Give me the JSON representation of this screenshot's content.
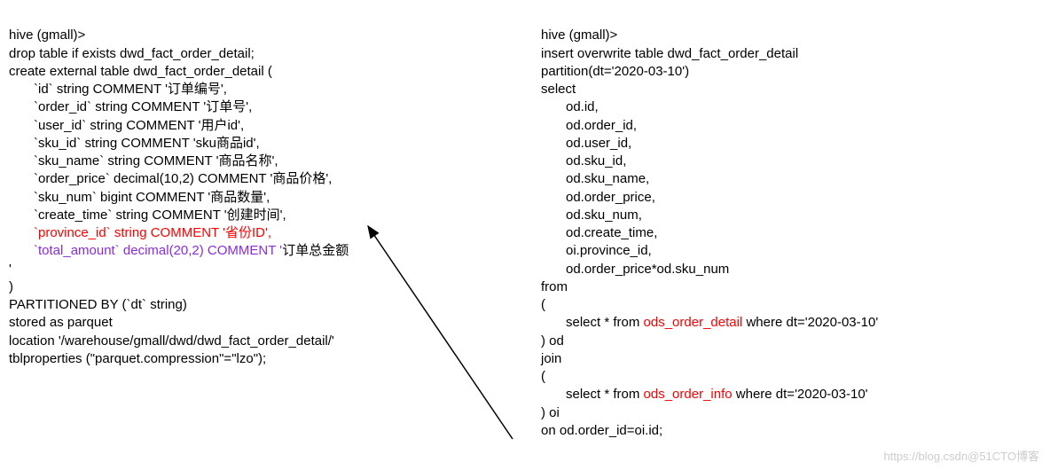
{
  "left": {
    "l1": "hive (gmall)>",
    "l2": "drop table if exists dwd_fact_order_detail;",
    "l3": "create external table dwd_fact_order_detail (",
    "l4": "`id` string COMMENT '订单编号',",
    "l5": "`order_id` string COMMENT '订单号',",
    "l6": "`user_id` string COMMENT '用户id',",
    "l7": "`sku_id` string COMMENT 'sku商品id',",
    "l8": "`sku_name` string COMMENT '商品名称',",
    "l9": "`order_price` decimal(10,2) COMMENT '商品价格',",
    "l10": "`sku_num` bigint COMMENT '商品数量',",
    "l11": "`create_time` string COMMENT '创建时间',",
    "l12": "`province_id` string COMMENT '省份ID',",
    "l13a": "`total_amount` decimal(20,2) COMMENT '",
    "l13b": "订单总金额",
    "l14": "'",
    "l15": ")",
    "l16": "PARTITIONED BY (`dt` string)",
    "l17": "stored as parquet",
    "l18": "location '/warehouse/gmall/dwd/dwd_fact_order_detail/'",
    "l19": "tblproperties (\"parquet.compression\"=\"lzo\");"
  },
  "right": {
    "r1": "hive (gmall)>",
    "r2": "insert overwrite table dwd_fact_order_detail",
    "r3": "partition(dt='2020-03-10')",
    "r4": "select",
    "r5": "od.id,",
    "r6": "od.order_id,",
    "r7": "od.user_id,",
    "r8": "od.sku_id,",
    "r9": "od.sku_name,",
    "r10": "od.order_price,",
    "r11": "od.sku_num,",
    "r12": "od.create_time,",
    "r13": "oi.province_id,",
    "r14": "od.order_price*od.sku_num",
    "r15": "from",
    "r16": "(",
    "r17a": "select * from ",
    "r17b": "ods_order_detail",
    "r17c": " where dt='2020-03-10'",
    "r18": ") od",
    "r19": "join",
    "r20": "(",
    "r21a": "select * from ",
    "r21b": "ods_order_info",
    "r21c": " where dt='2020-03-10'",
    "r22": ") oi",
    "r23": "on od.order_id=oi.id;"
  },
  "watermark": "https://blog.csdn@51CTO博客"
}
